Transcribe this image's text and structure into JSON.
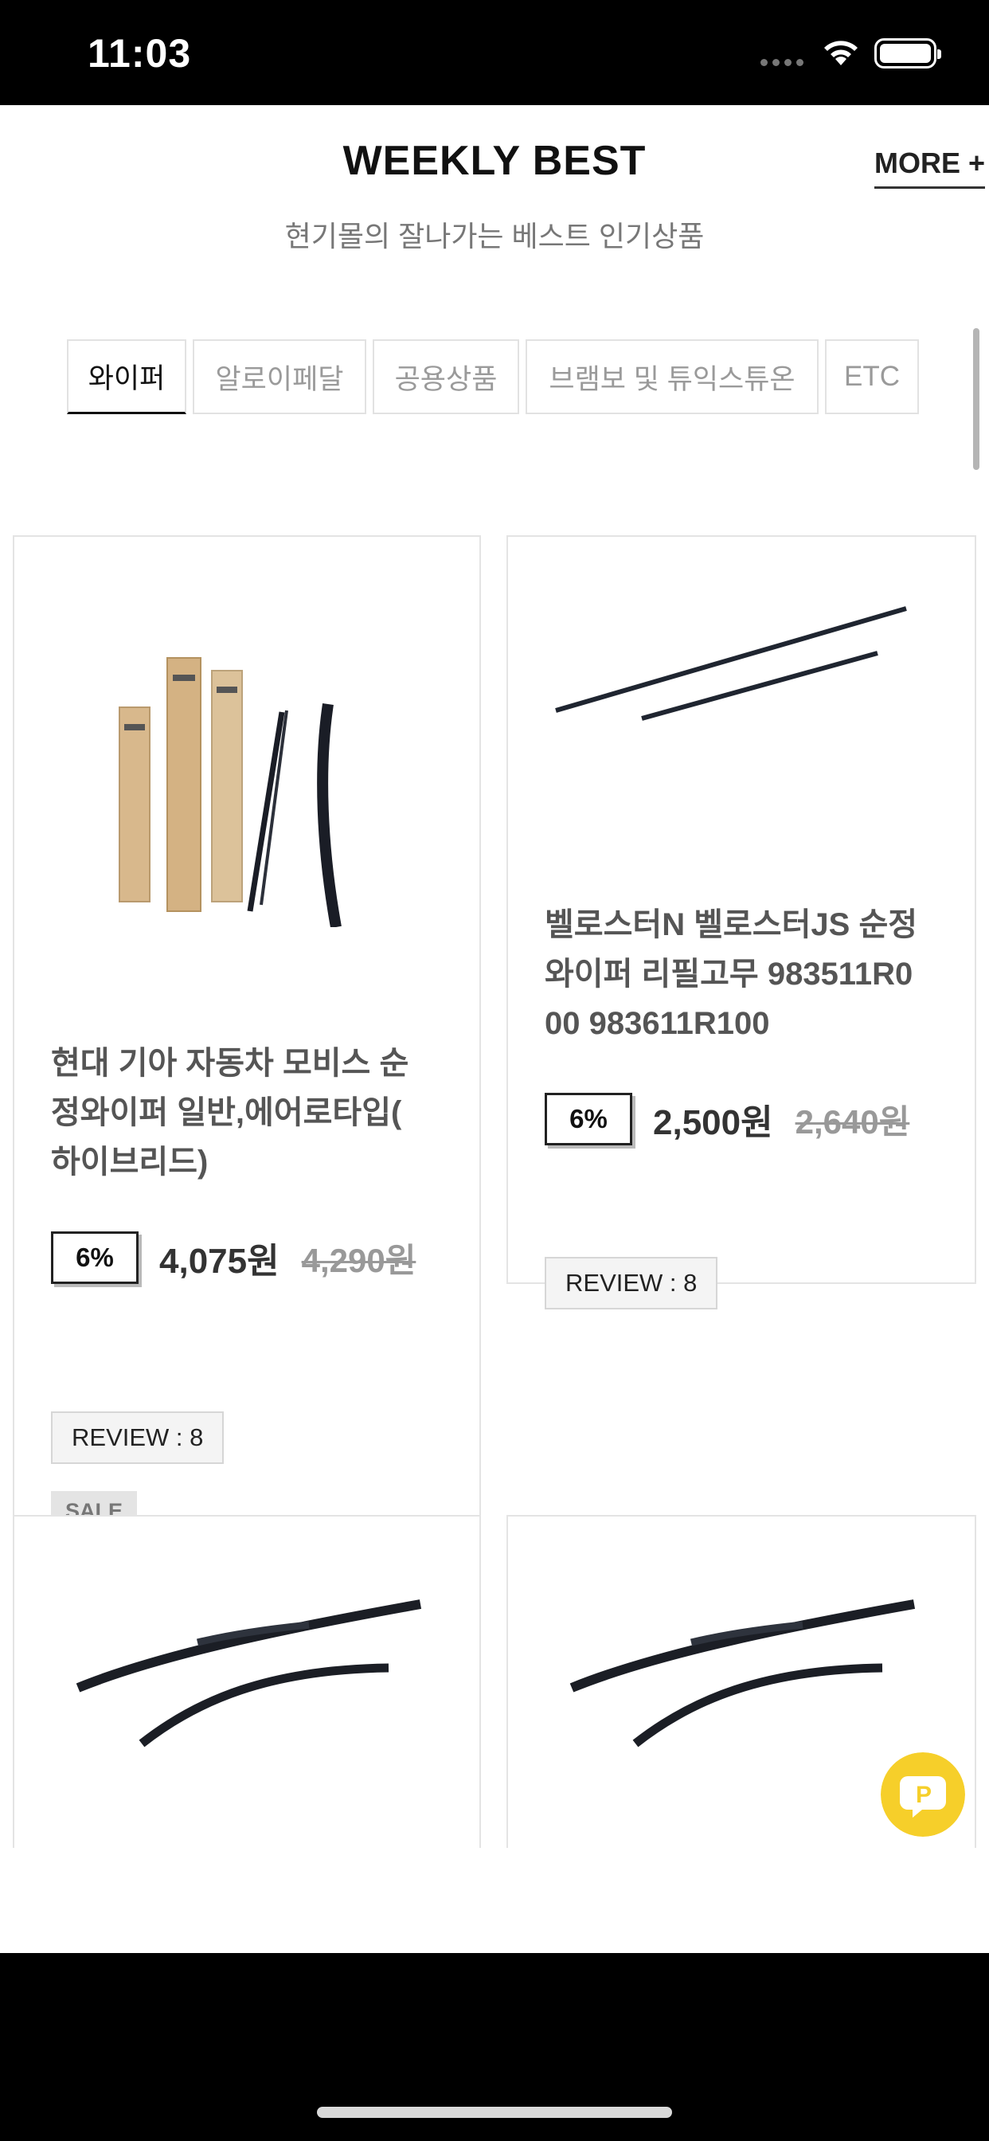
{
  "status_bar": {
    "time": "11:03"
  },
  "header": {
    "title": "WEEKLY BEST",
    "more_label": "MORE +",
    "subtitle": "현기몰의 잘나가는 베스트 인기상품"
  },
  "tabs": [
    {
      "label": "와이퍼",
      "active": true
    },
    {
      "label": "알로이페달",
      "active": false
    },
    {
      "label": "공용상품",
      "active": false
    },
    {
      "label": "브램보 및 튜익스튜온",
      "active": false
    },
    {
      "label": "ETC",
      "active": false
    }
  ],
  "products": [
    {
      "name_lines": [
        "현대 기아 자동차 모비스 순",
        "정와이퍼 일반,에어로타입(",
        "하이브리드)"
      ],
      "discount": "6%",
      "price": "4,075원",
      "original_price": "4,290원",
      "review": "REVIEW : 8",
      "badge": "SALE"
    },
    {
      "name_lines": [
        "벨로스터N 벨로스터JS 순정",
        "와이퍼 리필고무 983511R0",
        "00 983611R100"
      ],
      "discount": "6%",
      "price": "2,500원",
      "original_price": "2,640원",
      "review": "REVIEW : 8"
    }
  ],
  "icons": {
    "chat_fab": "chat-bubble-p-icon",
    "wifi": "wifi-icon",
    "battery": "battery-icon"
  },
  "colors": {
    "chat_fab": "#f6cf2a",
    "accent_text": "#111111"
  }
}
